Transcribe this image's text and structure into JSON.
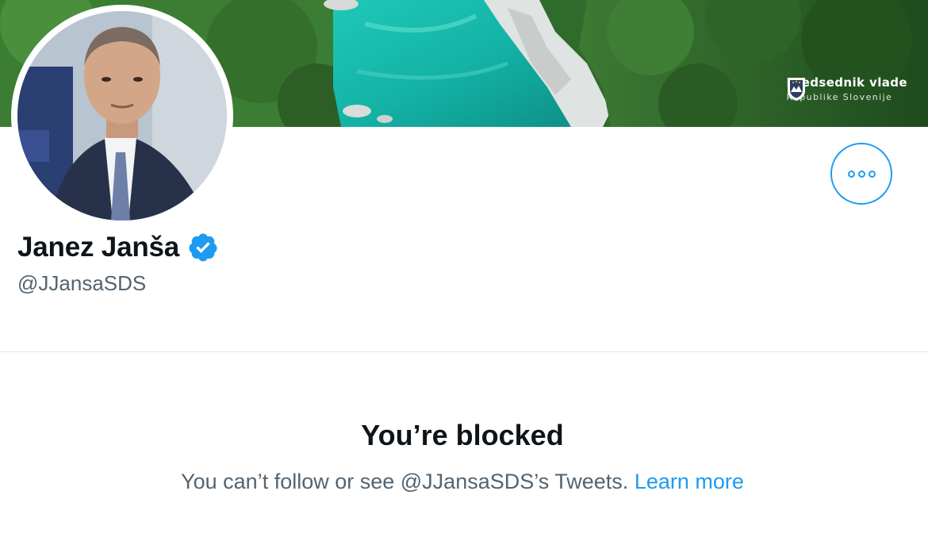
{
  "banner": {
    "brand_title": "Predsednik vlade",
    "brand_subtitle": "Republike Slovenije"
  },
  "profile": {
    "display_name": "Janez Janša",
    "handle": "@JJansaSDS",
    "verified": true
  },
  "blocked": {
    "title": "You’re blocked",
    "description": "You can’t follow or see @JJansaSDS’s Tweets.",
    "learn_more_label": "Learn more"
  },
  "colors": {
    "accent": "#1d9bf0",
    "text_primary": "#0f1419",
    "text_secondary": "#536471",
    "divider": "#e3e7ea"
  },
  "icons": {
    "more": "more-horizontal-icon",
    "verified": "verified-badge-icon",
    "crest": "coat-of-arms-icon"
  }
}
